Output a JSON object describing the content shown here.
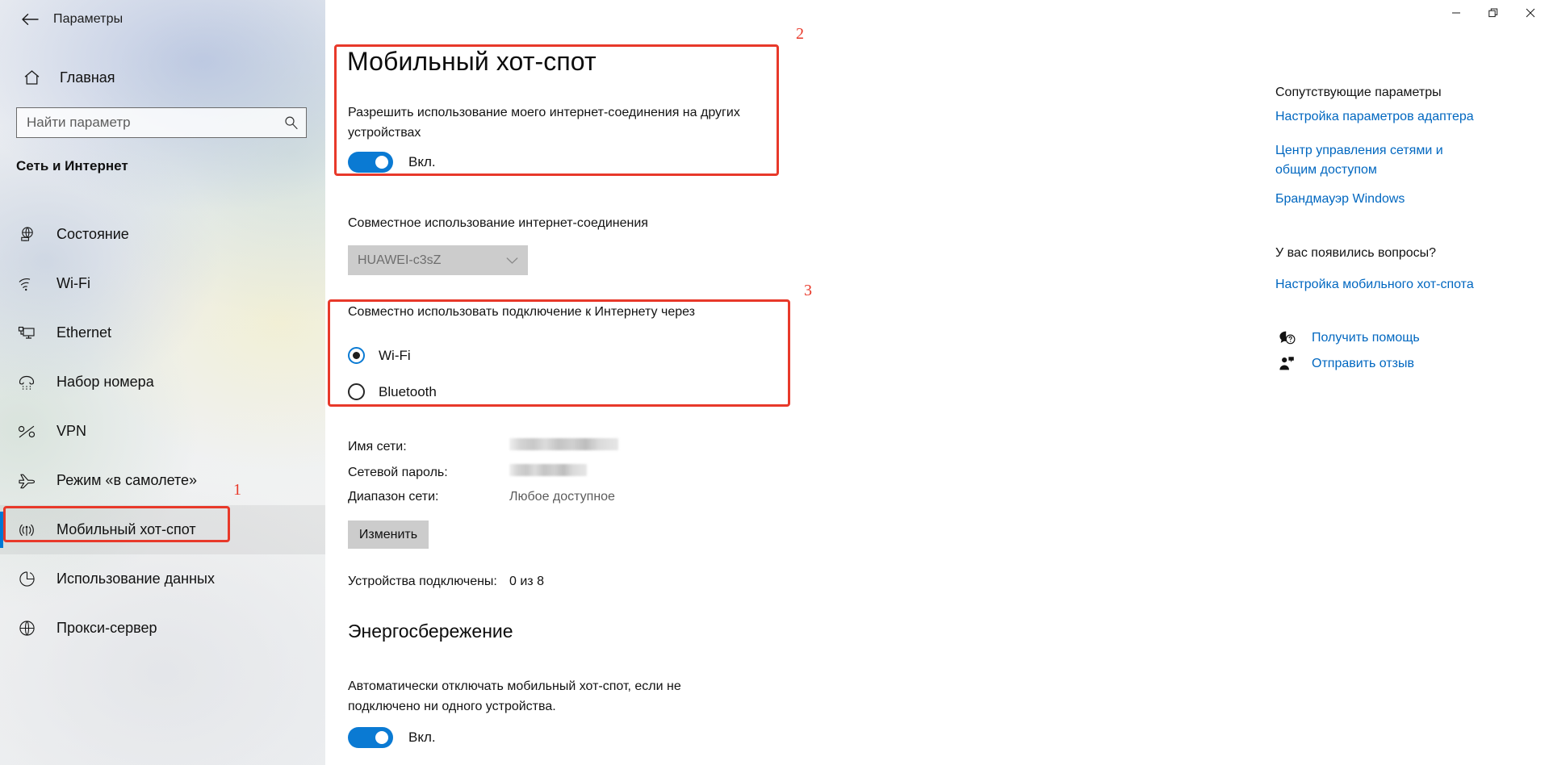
{
  "window": {
    "title": "Параметры",
    "back_icon": "back-arrow-icon",
    "controls": {
      "minimize": "minimize-icon",
      "maximize": "restore-icon",
      "close": "close-icon"
    }
  },
  "sidebar": {
    "home_label": "Главная",
    "home_icon": "home-icon",
    "search": {
      "placeholder": "Найти параметр",
      "value": "",
      "icon": "search-icon"
    },
    "section_heading": "Сеть и Интернет",
    "items": [
      {
        "label": "Состояние",
        "icon": "status-globe-icon",
        "selected": false
      },
      {
        "label": "Wi-Fi",
        "icon": "wifi-icon",
        "selected": false
      },
      {
        "label": "Ethernet",
        "icon": "ethernet-icon",
        "selected": false
      },
      {
        "label": "Набор номера",
        "icon": "dialup-phone-icon",
        "selected": false
      },
      {
        "label": "VPN",
        "icon": "vpn-key-icon",
        "selected": false
      },
      {
        "label": "Режим «в самолете»",
        "icon": "airplane-icon",
        "selected": false
      },
      {
        "label": "Мобильный хот-спот",
        "icon": "hotspot-icon",
        "selected": true
      },
      {
        "label": "Использование данных",
        "icon": "data-usage-pie-icon",
        "selected": false
      },
      {
        "label": "Прокси-сервер",
        "icon": "proxy-globe-icon",
        "selected": false
      }
    ]
  },
  "main": {
    "page_title": "Мобильный хот-спот",
    "share_description": "Разрешить использование моего интернет-соединения на других устройствах",
    "main_toggle": {
      "state_label": "Вкл.",
      "on": true
    },
    "internet_share_label": "Совместное использование интернет-соединения",
    "internet_share_select": {
      "value": "HUAWEI-c3sZ",
      "disabled": true,
      "chevron_icon": "chevron-down-icon"
    },
    "share_via_label": "Совместно использовать подключение к Интернету через",
    "share_via_options": [
      {
        "label": "Wi-Fi",
        "checked": true
      },
      {
        "label": "Bluetooth",
        "checked": false
      }
    ],
    "network_info": [
      {
        "key": "Имя сети:",
        "value": "",
        "redacted": true
      },
      {
        "key": "Сетевой пароль:",
        "value": "",
        "redacted": true
      },
      {
        "key": "Диапазон сети:",
        "value": "Любое доступное",
        "redacted": false
      }
    ],
    "change_button": "Изменить",
    "devices": {
      "key": "Устройства подключены:",
      "value": "0 из 8"
    },
    "energy": {
      "title": "Энергосбережение",
      "description": "Автоматически отключать мобильный хот-спот, если не подключено ни одного устройства.",
      "toggle": {
        "state_label": "Вкл.",
        "on": true
      }
    }
  },
  "right_panel": {
    "related_heading": "Сопутствующие параметры",
    "link_adapter": "Настройка параметров адаптера",
    "link_network_center": "Центр управления сетями и общим доступом",
    "link_firewall": "Брандмауэр Windows",
    "questions_heading": "У вас появились вопросы?",
    "link_hotspot_setup": "Настройка мобильного хот-спота",
    "help_row": {
      "label": "Получить помощь",
      "icon": "help-chat-icon"
    },
    "feedback_row": {
      "label": "Отправить отзыв",
      "icon": "feedback-person-icon"
    }
  },
  "annotations": {
    "one": "1",
    "two": "2",
    "three": "3",
    "color": "#e8392a"
  },
  "colors": {
    "accent": "#0078d4",
    "toggle_on": "#0a7ad3",
    "link": "#0067c0",
    "annotation_red": "#e8392a",
    "disabled_bg": "#cccccc"
  }
}
